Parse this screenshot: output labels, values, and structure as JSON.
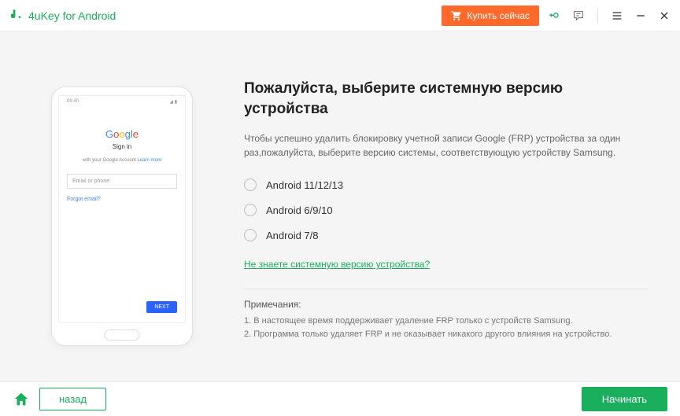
{
  "titlebar": {
    "app_name": "4uKey for Android",
    "buy_label": "Купить сейчас"
  },
  "phone": {
    "time": "09:40",
    "google": "Google",
    "signin": "Sign in",
    "subtext_prefix": "with your Google Account ",
    "subtext_link": "Learn more",
    "email_placeholder": "Email or phone",
    "forgot": "Forgot email?",
    "next": "NEXT"
  },
  "main": {
    "heading": "Пожалуйста, выберите системную версию устройства",
    "description": "Чтобы успешно удалить блокировку учетной записи Google (FRP) устройства за один раз,пожалуйста, выберите версию системы, соответствующую устройству Samsung.",
    "options": [
      "Android 11/12/13",
      "Android 6/9/10",
      "Android 7/8"
    ],
    "help_link": "Не знаете системную версию устройства?",
    "notes_title": "Примечания:",
    "note1": "1. В настоящее время поддерживает удаление FRP только с устройств Samsung.",
    "note2": "2. Программа только удаляет FRP и не оказывает никакого другого влияния на устройство."
  },
  "footer": {
    "back": "назад",
    "start": "Начинать"
  }
}
